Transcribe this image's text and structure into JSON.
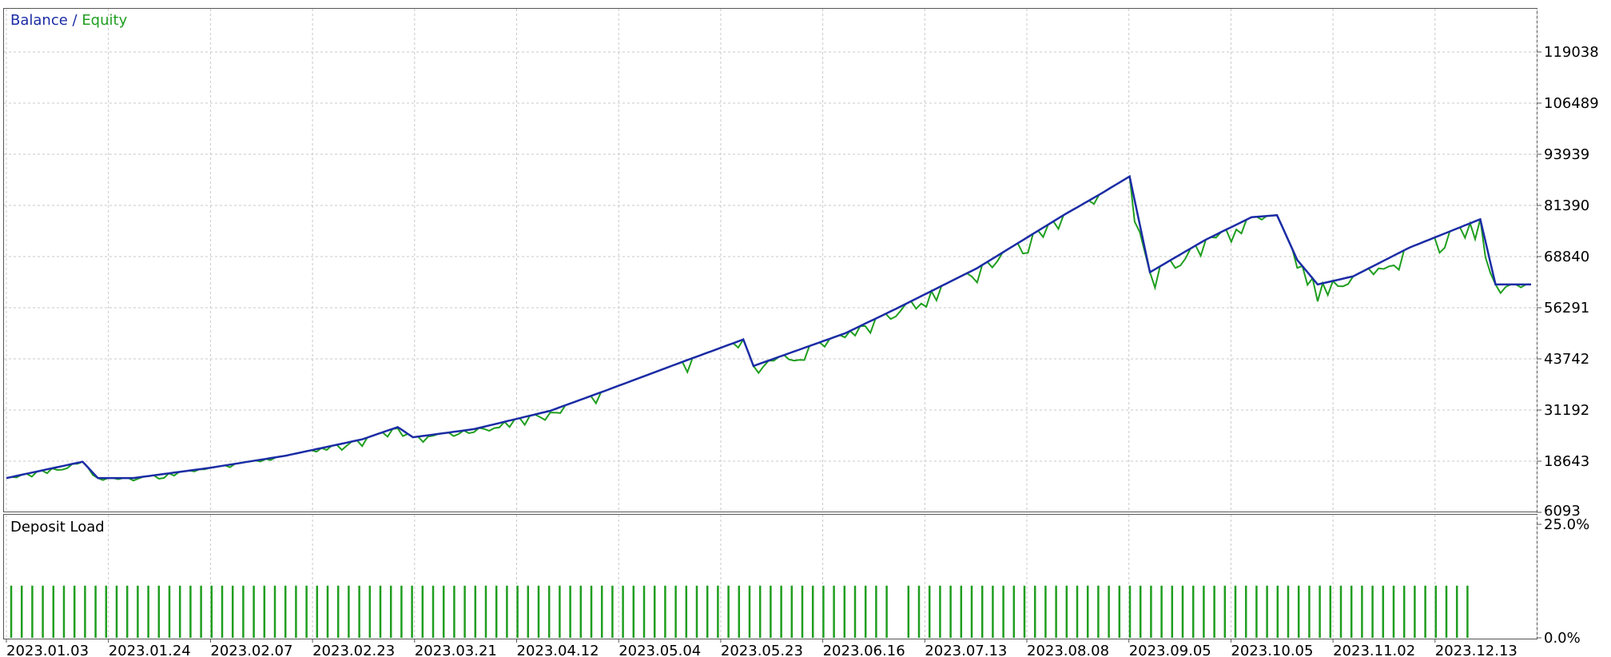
{
  "legend": {
    "balance": "Balance",
    "separator": " / ",
    "equity": "Equity"
  },
  "colors": {
    "balance": "#1b2ca5",
    "equity": "#1f9e1f",
    "deposit": "#1f9e1f",
    "grid": "#c8c8c8"
  },
  "chart_data": [
    {
      "type": "line",
      "series": [
        {
          "name": "Balance"
        },
        {
          "name": "Equity"
        }
      ],
      "ylim": [
        6093,
        122000
      ],
      "yticks": [
        "119038",
        "106489",
        "93939",
        "81390",
        "68840",
        "56291",
        "43742",
        "31192",
        "18643",
        "6093"
      ],
      "ytick_values": [
        119038,
        106489,
        93939,
        81390,
        68840,
        56291,
        43742,
        31192,
        18643,
        6093
      ],
      "xticks": [
        "2023.01.03",
        "2023.01.24",
        "2023.02.07",
        "2023.02.23",
        "2023.03.21",
        "2023.04.12",
        "2023.05.04",
        "2023.05.23",
        "2023.06.16",
        "2023.07.13",
        "2023.08.08",
        "2023.09.05",
        "2023.10.05",
        "2023.11.02",
        "2023.12.13"
      ],
      "trades": 300,
      "keypoints": [
        [
          0,
          14500
        ],
        [
          15,
          18500
        ],
        [
          18,
          14500
        ],
        [
          25,
          14500
        ],
        [
          40,
          17000
        ],
        [
          55,
          20000
        ],
        [
          70,
          24000
        ],
        [
          77,
          27000
        ],
        [
          80,
          24500
        ],
        [
          92,
          26500
        ],
        [
          107,
          31000
        ],
        [
          118,
          36000
        ],
        [
          133,
          43000
        ],
        [
          145,
          48500
        ],
        [
          147,
          42000
        ],
        [
          165,
          50000
        ],
        [
          175,
          56000
        ],
        [
          191,
          66000
        ],
        [
          208,
          79000
        ],
        [
          215,
          84000
        ],
        [
          221,
          88500
        ],
        [
          225,
          65000
        ],
        [
          236,
          73000
        ],
        [
          245,
          78500
        ],
        [
          250,
          79000
        ],
        [
          254,
          68000
        ],
        [
          258,
          62000
        ],
        [
          265,
          64000
        ],
        [
          276,
          71000
        ],
        [
          290,
          78000
        ],
        [
          293,
          62000
        ],
        [
          300,
          62000
        ]
      ],
      "grid": true,
      "legend_position": "top-left"
    },
    {
      "type": "bar",
      "title": "Deposit Load",
      "ylim": [
        0,
        25
      ],
      "yticks": [
        "25.0%",
        "0.0%"
      ],
      "bar_value_percent": 11.5,
      "bar_count": 138,
      "gap_after_bar": 83,
      "grid": true
    }
  ]
}
